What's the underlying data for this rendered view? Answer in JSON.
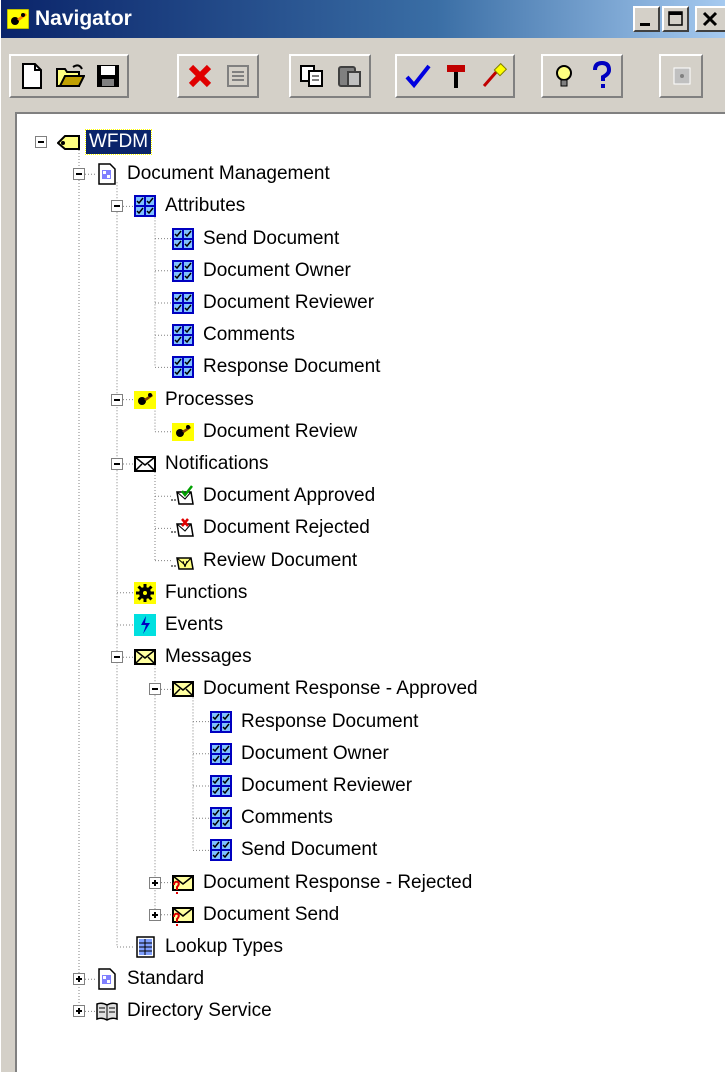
{
  "window": {
    "title": "Navigator",
    "icon": "workflow-process-icon",
    "controls": [
      "minimize-icon",
      "maximize-icon",
      "close-icon"
    ]
  },
  "toolbar": {
    "groups": [
      [
        "new-document-icon",
        "open-folder-icon",
        "save-disk-icon"
      ],
      [
        "delete-x-icon",
        "properties-icon"
      ],
      [
        "copy-icon",
        "paste-icon"
      ],
      [
        "verify-check-icon",
        "hammer-icon",
        "eraser-icon"
      ],
      [
        "lightbulb-icon",
        "help-question-icon"
      ],
      [
        "disabled-icon"
      ]
    ]
  },
  "colors": {
    "title_gradient_start": "#0a246a",
    "title_gradient_end": "#a6caf0",
    "selection": "#0a246a",
    "window_bg": "#d4d0c8"
  },
  "tree": {
    "nodes": [
      {
        "label": "WFDM",
        "icon": "item-type-icon",
        "depth": 0,
        "expander": "minus",
        "selected": true
      },
      {
        "label": "Document Management",
        "icon": "data-store-icon",
        "depth": 1,
        "expander": "minus"
      },
      {
        "label": "Attributes",
        "icon": "attribute-icon",
        "depth": 2,
        "expander": "minus"
      },
      {
        "label": "Send Document",
        "icon": "attribute-icon",
        "depth": 3
      },
      {
        "label": "Document Owner",
        "icon": "attribute-icon",
        "depth": 3
      },
      {
        "label": "Document Reviewer",
        "icon": "attribute-icon",
        "depth": 3
      },
      {
        "label": "Comments",
        "icon": "attribute-icon",
        "depth": 3
      },
      {
        "label": "Response Document",
        "icon": "attribute-icon",
        "depth": 3
      },
      {
        "label": "Processes",
        "icon": "process-icon",
        "depth": 2,
        "expander": "minus"
      },
      {
        "label": "Document Review",
        "icon": "process-icon",
        "depth": 3
      },
      {
        "label": "Notifications",
        "icon": "notification-icon",
        "depth": 2,
        "expander": "minus"
      },
      {
        "label": "Document Approved",
        "icon": "notification-approved-icon",
        "depth": 3
      },
      {
        "label": "Document Rejected",
        "icon": "notification-rejected-icon",
        "depth": 3
      },
      {
        "label": "Review Document",
        "icon": "notification-review-icon",
        "depth": 3
      },
      {
        "label": "Functions",
        "icon": "function-gear-icon",
        "depth": 2
      },
      {
        "label": "Events",
        "icon": "event-lightning-icon",
        "depth": 2
      },
      {
        "label": "Messages",
        "icon": "message-envelope-icon",
        "depth": 2,
        "expander": "minus"
      },
      {
        "label": "Document Response - Approved",
        "icon": "message-envelope-icon",
        "depth": 3,
        "expander": "minus"
      },
      {
        "label": "Response Document",
        "icon": "attribute-icon",
        "depth": 4
      },
      {
        "label": "Document Owner",
        "icon": "attribute-icon",
        "depth": 4
      },
      {
        "label": "Document Reviewer",
        "icon": "attribute-icon",
        "depth": 4
      },
      {
        "label": "Comments",
        "icon": "attribute-icon",
        "depth": 4
      },
      {
        "label": "Send Document",
        "icon": "attribute-icon",
        "depth": 4
      },
      {
        "label": "Document Response - Rejected",
        "icon": "message-envelope-question-icon",
        "depth": 3,
        "expander": "plus"
      },
      {
        "label": "Document Send",
        "icon": "message-envelope-question-icon",
        "depth": 3,
        "expander": "plus"
      },
      {
        "label": "Lookup Types",
        "icon": "lookup-type-icon",
        "depth": 2
      },
      {
        "label": "Standard",
        "icon": "data-store-icon",
        "depth": 1,
        "expander": "plus"
      },
      {
        "label": "Directory Service",
        "icon": "directory-book-icon",
        "depth": 1,
        "expander": "plus"
      }
    ]
  }
}
